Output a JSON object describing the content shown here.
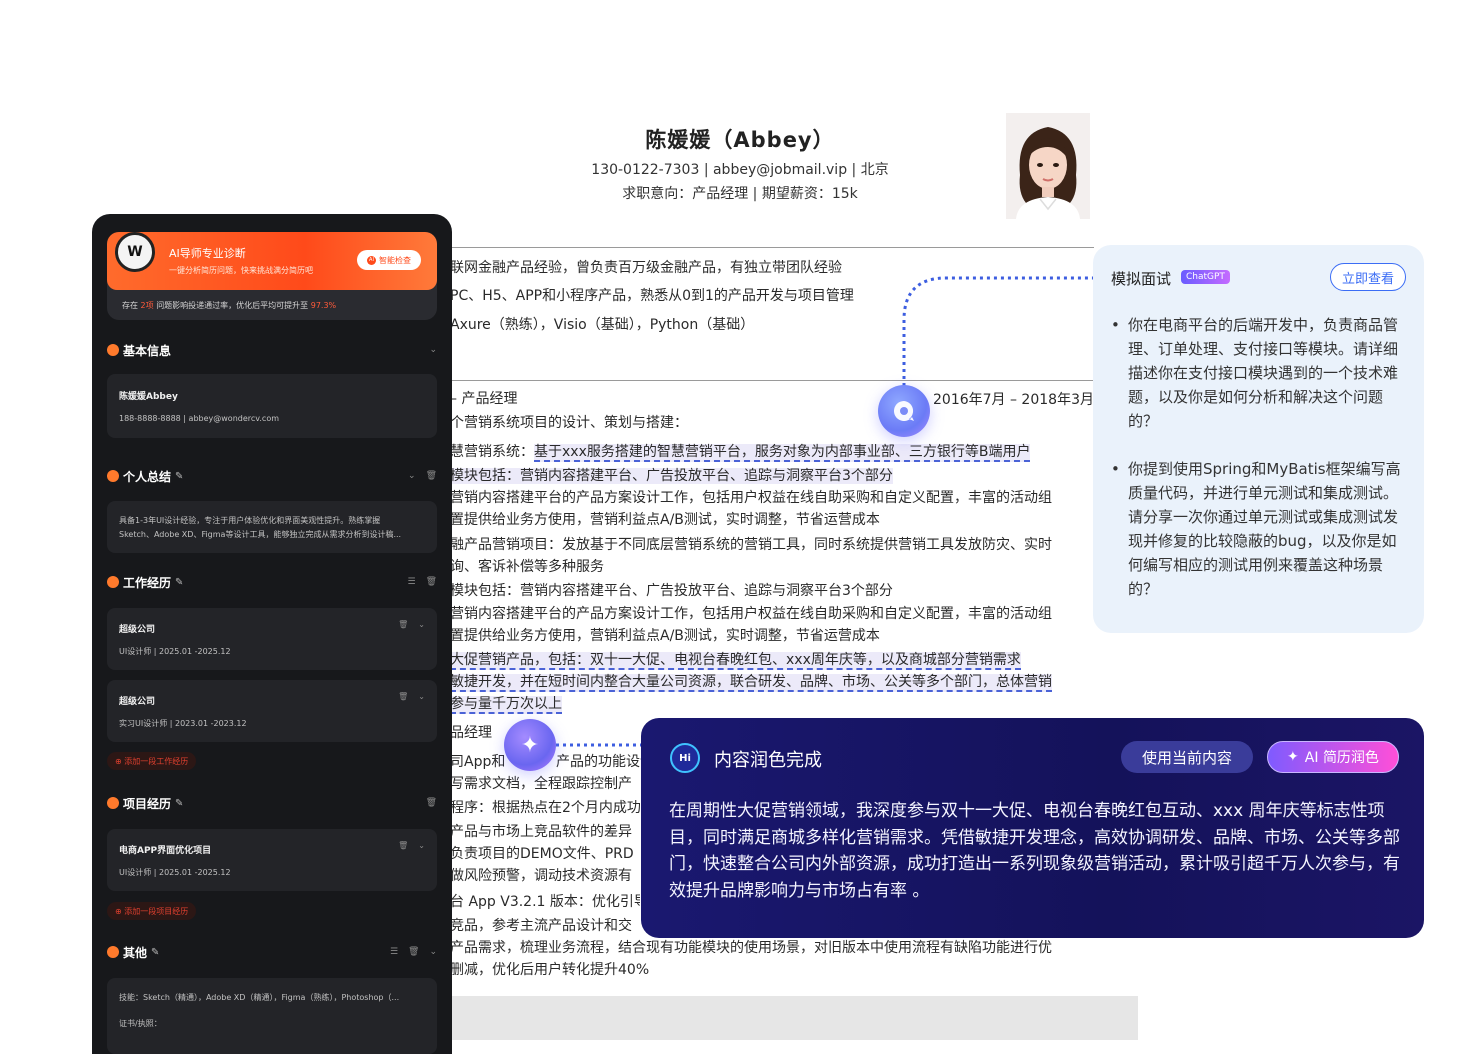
{
  "resume": {
    "name": "陈媛媛（Abbey）",
    "contact": "130-0122-7303 | abbey@jobmail.vip | 北京",
    "intent": "求职意向：产品经理 |  期望薪资：15k",
    "date_range": "2016年7月 – 2018年3月",
    "lines": [
      "联网金融产品经验，曾负责百万级金融产品，有独立带团队经验",
      "PC、H5、APP和小程序产品，熟悉从0到1的产品开发与项目管理",
      "Axure（熟练），Visio（基础），Python（基础）",
      "– 产品经理",
      "个营销系统项目的设计、策划与搭建：",
      "慧营销系统：",
      "基于xxx服务搭建的智慧营销平台，服务对象为内部事业部、三方银行等B端用户",
      "模块包括：营销内容搭建平台、广告投放平台、追踪与洞察平台3个部分",
      "营销内容搭建平台的产品方案设计工作，包括用户权益在线自助采购和自定义配置，丰富的活动组",
      "置提供给业务方使用，营销利益点A/B测试，实时调整，节省运营成本",
      "融产品营销项目：发放基于不同底层营销系统的营销工具，同时系统提供营销工具发放防灾、实时",
      "询、客诉补偿等多种服务",
      "模块包括：营销内容搭建平台、广告投放平台、追踪与洞察平台3个部分",
      "营销内容搭建平台的产品方案设计工作，包括用户权益在线自助采购和自定义配置，丰富的活动组",
      "置提供给业务方使用，营销利益点A/B测试，实时调整，节省运营成本",
      "大促营销产品，包括：双十一大促、电视台春晚红包、xxx周年庆等，以及商城部分营销需求",
      "敏捷开发，并在短时间内整合大量公司资源，联合研发、品牌、市场、公关等多个部门，总体营销",
      "参与量千万次以上",
      "品经理",
      "司App和",
      "产品的功能设计",
      "写需求文档，全程跟踪控制产",
      "程序：根据热点在2个月内成功",
      "产品与市场上竞品软件的差异",
      "负责项目的DEMO文件、PRD",
      "做风险预警，调动技术资源有",
      "台 App V3.2.1 版本：优化引导",
      "竞品，参考主流产品设计和交",
      "产品需求，梳理业务流程，结合现有功能模块的使用场景，对旧版本中使用流程有缺陷功能进行优",
      "删减，优化后用户转化提升40%"
    ]
  },
  "panel": {
    "diag": {
      "avatar": "W",
      "title": "AI导师专业诊断",
      "subtitle": "一键分析简历问题，快来挑战满分简历吧",
      "button": "智能检查",
      "button_icon": "AI",
      "stat_prefix": "存在",
      "stat_count": "2项",
      "stat_mid": "问题影响投递通过率，优化后平均可提升至",
      "stat_pct": "97.3%"
    },
    "sections": {
      "basic": "基本信息",
      "summary": "个人总结",
      "work": "工作经历",
      "project": "项目经历",
      "other": "其他"
    },
    "basic_card": {
      "name": "陈媛媛Abbey",
      "contact": "188-8888-8888 | abbey@wondercv.com"
    },
    "summary_card": {
      "line1": "具备1-3年UI设计经验，专注于用户体验优化和界面美观性提升。熟练掌握",
      "line2": "Sketch、Adobe XD、Figma等设计工具，能够独立完成从需求分析到设计稿..."
    },
    "work_cards": [
      {
        "company": "超级公司",
        "detail": "UI设计师 | 2025.01 -2025.12"
      },
      {
        "company": "超级公司",
        "detail": "实习UI设计师 | 2023.01 -2023.12"
      }
    ],
    "add_work": "添加一段工作经历",
    "project_card": {
      "name": "电商APP界面优化项目",
      "detail": "UI设计师 | 2025.01 -2025.12"
    },
    "add_project": "添加一段项目经历",
    "other_card": {
      "skills": "技能：Sketch（精通），Adobe XD（精通），Figma（熟练），Photoshop（...",
      "certs": "证书/执照："
    }
  },
  "interview": {
    "title": "模拟面试",
    "badge": "ChatGPT",
    "button": "立即查看",
    "questions": [
      "你在电商平台的后端开发中，负责商品管理、订单处理、支付接口等模块。请详细描述你在支付接口模块遇到的一个技术难题，以及你是如何分析和解决这个问题的？",
      "你提到使用Spring和MyBatis框架编写高质量代码，并进行单元测试和集成测试。请分享一次你通过单元测试或集成测试发现并修复的比较隐蔽的bug，以及你是如何编写相应的测试用例来覆盖这种场景的？"
    ]
  },
  "polish": {
    "logo": "Hi",
    "title": "内容润色完成",
    "use_button": "使用当前内容",
    "ai_button": "AI 简历润色",
    "text": "在周期性大促营销领域，我深度参与双十一大促、电视台春晚红包互动、xxx 周年庆等标志性项目，同时满足商城多样化营销需求。凭借敏捷开发理念，高效协调研发、品牌、市场、公关等多部门，快速整合公司内外部资源，成功打造出一系列现象级营销活动，累计吸引超千万人次参与，有效提升品牌影响力与市场占有率 。"
  }
}
